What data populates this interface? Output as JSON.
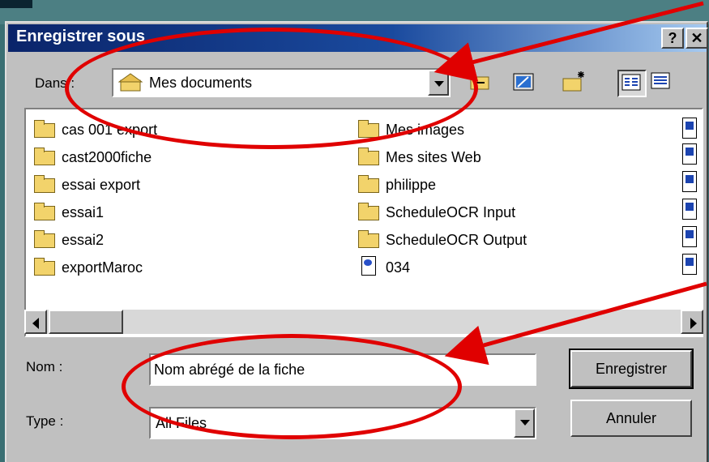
{
  "dialog": {
    "title": "Enregistrer sous",
    "help_button": "?",
    "close_button": "✕"
  },
  "location": {
    "label": "Dans :",
    "value": "Mes documents"
  },
  "toolbar": {
    "icons": [
      "up-one-level-icon",
      "desktop-icon",
      "new-folder-icon",
      "list-view-icon",
      "details-view-icon"
    ]
  },
  "files": {
    "column1": [
      "cas 001 export",
      "cast2000fiche",
      "essai export",
      "essai1",
      "essai2",
      "exportMaroc"
    ],
    "column2": [
      "Mes images",
      "Mes sites Web",
      "philippe",
      "ScheduleOCR Input",
      "ScheduleOCR Output",
      "034"
    ]
  },
  "name_field": {
    "label": "Nom :",
    "value": "Nom abrégé de la fiche"
  },
  "type_field": {
    "label": "Type :",
    "value": "All Files"
  },
  "buttons": {
    "save": "Enregistrer",
    "cancel": "Annuler"
  },
  "annotation_color": "#e00000"
}
